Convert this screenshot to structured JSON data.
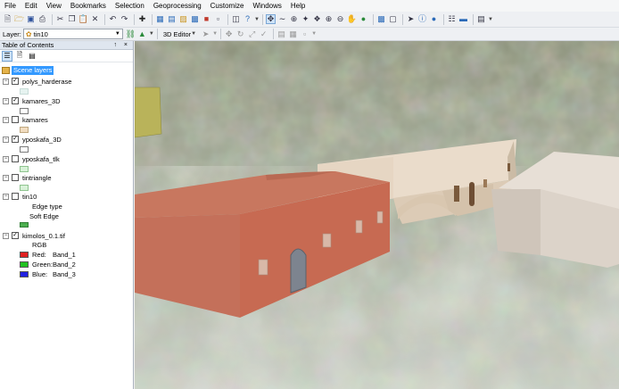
{
  "menu": [
    "File",
    "Edit",
    "View",
    "Bookmarks",
    "Selection",
    "Geoprocessing",
    "Customize",
    "Windows",
    "Help"
  ],
  "toolbar": {
    "layer_label": "Layer:",
    "layer_value": "tin10",
    "editor_label": "3D Editor",
    "icons": [
      "new-icon",
      "open-icon",
      "save-icon",
      "print-icon",
      "cut-icon",
      "copy-icon",
      "paste-icon",
      "delete-icon",
      "undo-icon",
      "redo-icon",
      "add-data-icon",
      "navigate-icon",
      "zoom-in-icon",
      "zoom-out-icon",
      "pan-icon",
      "globe-icon",
      "select-icon",
      "identify-icon",
      "find-icon",
      "measure-icon"
    ]
  },
  "toc": {
    "title": "Table of Contents",
    "header_buttons": "↑ ×",
    "root_label": "Scene layers",
    "layers": [
      {
        "name": "polys_harderase",
        "checked": true,
        "swatch": "#e6f3f0"
      },
      {
        "name": "kamares_3D",
        "checked": true,
        "swatch": "#ffffff"
      },
      {
        "name": "kamares",
        "checked": false,
        "swatch": "#f1dcc0"
      },
      {
        "name": "yposkafa_3D",
        "checked": true,
        "swatch": "#ffffff"
      },
      {
        "name": "yposkafa_tlk",
        "checked": false,
        "swatch": "#d8f2d8"
      },
      {
        "name": "tintriangle",
        "checked": false,
        "swatch": "#d8f2d8"
      },
      {
        "name": "tin10",
        "checked": false,
        "swatch": "#4caf50"
      },
      {
        "name": "kimolos_0.1.tif",
        "checked": true,
        "swatch": ""
      }
    ],
    "tin_edge_type": "Edge type",
    "tin_soft_edge": "Soft Edge",
    "raster_rgb": "RGB",
    "bands": [
      {
        "channel": "Red:",
        "band": "Band_1",
        "color": "#e02020"
      },
      {
        "channel": "Green:",
        "band": "Band_2",
        "color": "#20c020"
      },
      {
        "channel": "Blue:",
        "band": "Band_3",
        "color": "#2020e0"
      }
    ]
  },
  "colors": {
    "selection": "#3399ff",
    "building_red": "#c96e58",
    "building_beige": "#e2d2bf"
  }
}
